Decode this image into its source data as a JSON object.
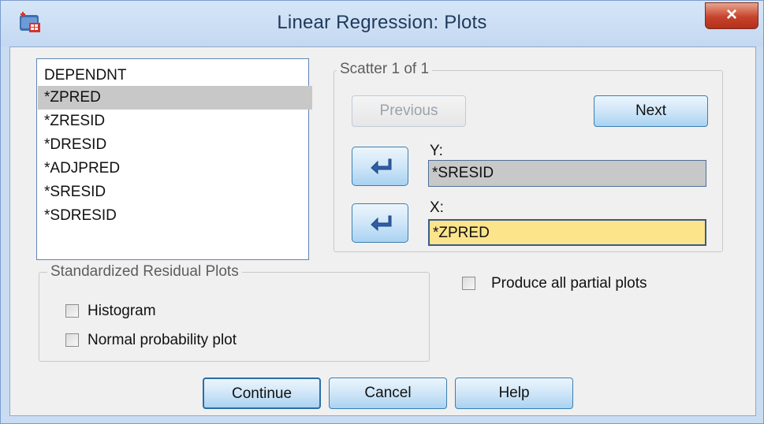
{
  "window": {
    "title": "Linear Regression: Plots",
    "close_label": "×"
  },
  "variables": {
    "items": [
      "DEPENDNT",
      "*ZPRED",
      "*ZRESID",
      "*DRESID",
      "*ADJPRED",
      "*SRESID",
      "*SDRESID"
    ],
    "selected": "*ZPRED"
  },
  "scatter": {
    "legend": "Scatter 1 of 1",
    "previous_label": "Previous",
    "next_label": "Next",
    "y_label": "Y:",
    "y_value": "*SRESID",
    "x_label": "X:",
    "x_value": "*ZPRED"
  },
  "residual_plots": {
    "legend": "Standardized Residual Plots",
    "histogram_label": "Histogram",
    "histogram_checked": false,
    "normal_label": "Normal probability plot",
    "normal_checked": false
  },
  "partial_plots": {
    "label": "Produce all partial plots",
    "checked": false
  },
  "buttons": {
    "continue": "Continue",
    "cancel": "Cancel",
    "help": "Help"
  },
  "colors": {
    "x_field_bg": "#fce48a",
    "y_field_bg": "#c8c8c8",
    "accent": "#3c7fb1"
  }
}
